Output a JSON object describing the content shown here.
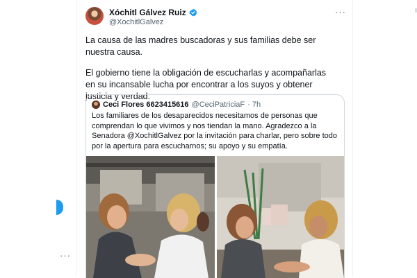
{
  "tweet": {
    "author_name": "Xóchitl Gálvez Ruiz",
    "author_handle": "@XochitlGalvez",
    "paragraph_1": "La causa de las madres buscadoras y sus familias debe ser nuestra causa.",
    "paragraph_2": "El gobierno tiene la obligación de escucharlas y acompañarlas en su incansable lucha por encontrar a los suyos y obtener justicia y verdad.",
    "more_symbol": "···"
  },
  "quoted_tweet": {
    "author_name": "Ceci Flores 6623415616",
    "author_handle": "@CeciPatriciaF",
    "time": "· 7h",
    "text": "Los familiares de los desaparecidos necesitamos de personas que comprendan lo que vivimos y nos tiendan la mano. Agradezco a la Senadora @XochitlGalvez por la invitación para charlar, pero sobre todo por la apertura para escucharnos; su apoyo y su empatía."
  },
  "sidebar": {
    "more_symbol": "···"
  },
  "icons": {
    "verified": "verified-badge-icon",
    "more": "more-dots-icon"
  },
  "colors": {
    "accent": "#1d9bf0",
    "text": "#0f1419",
    "muted": "#536471",
    "border": "#cfd9de"
  }
}
